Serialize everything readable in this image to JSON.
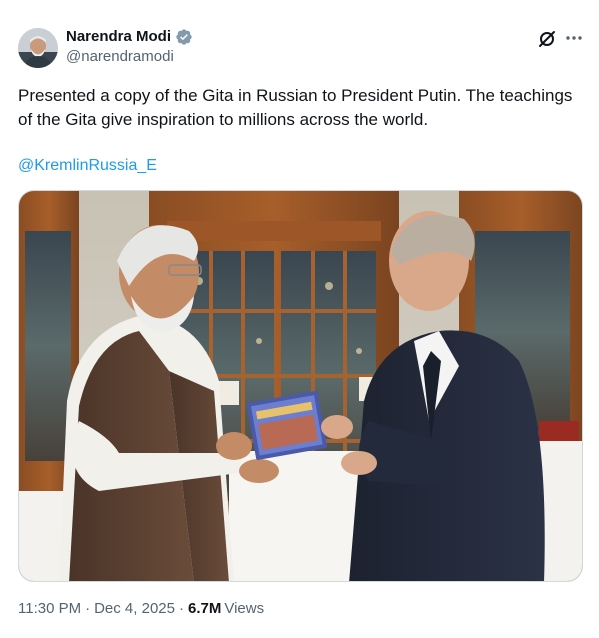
{
  "author": {
    "name": "Narendra Modi",
    "handle": "@narendramodi",
    "verified_color": "#1d9bf0"
  },
  "tweet": {
    "text": "Presented a copy of the Gita in Russian to President Putin. The teachings of the Gita give inspiration to millions across the world.",
    "mention": "@KremlinRussia_E"
  },
  "meta": {
    "time": "11:30 PM",
    "date": "Dec 4, 2025",
    "views_count": "6.7M",
    "views_label": "Views"
  },
  "icons": {
    "verified": "verified-badge-icon",
    "grok": "grok-icon",
    "more": "more-icon"
  },
  "colors": {
    "text": "#0f1419",
    "secondary": "#536471",
    "link": "#1d9bf0",
    "border": "#cfd9de"
  }
}
